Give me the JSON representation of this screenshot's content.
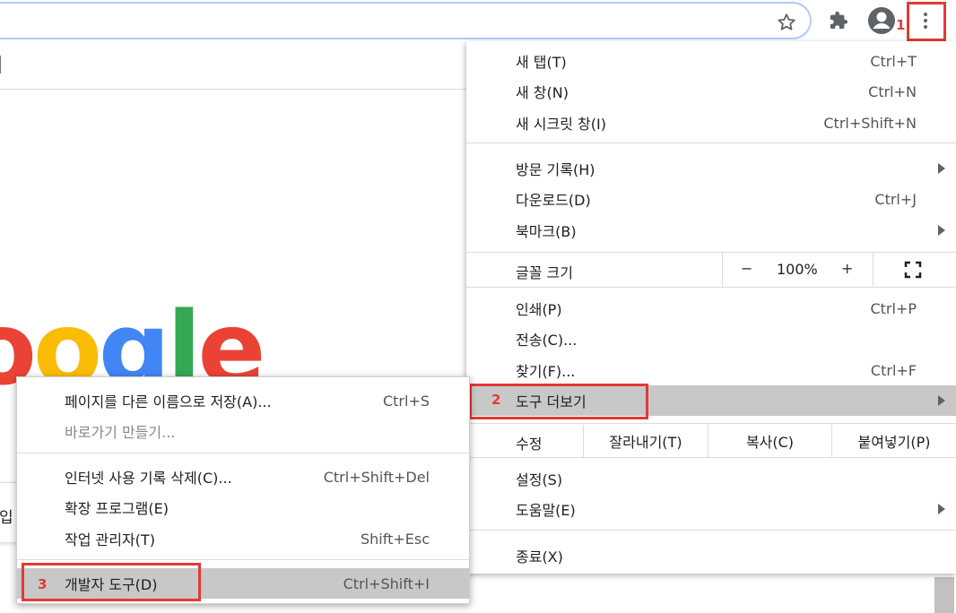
{
  "toolbar": {
    "step1": "1"
  },
  "menu": {
    "new_tab": {
      "label": "새 탭(T)",
      "shortcut": "Ctrl+T"
    },
    "new_window": {
      "label": "새 창(N)",
      "shortcut": "Ctrl+N"
    },
    "incognito": {
      "label": "새 시크릿 창(I)",
      "shortcut": "Ctrl+Shift+N"
    },
    "history": {
      "label": "방문 기록(H)"
    },
    "downloads": {
      "label": "다운로드(D)",
      "shortcut": "Ctrl+J"
    },
    "bookmarks": {
      "label": "북마크(B)"
    },
    "zoom": {
      "label": "글꼴 크기",
      "minus": "−",
      "value": "100%",
      "plus": "+"
    },
    "print": {
      "label": "인쇄(P)",
      "shortcut": "Ctrl+P"
    },
    "cast": {
      "label": "전송(C)..."
    },
    "find": {
      "label": "찾기(F)...",
      "shortcut": "Ctrl+F"
    },
    "more_tools": {
      "label": "도구 더보기",
      "step": "2"
    },
    "edit": {
      "label": "수정",
      "cut": "잘라내기(T)",
      "copy": "복사(C)",
      "paste": "붙여넣기(P)"
    },
    "settings": {
      "label": "설정(S)"
    },
    "help": {
      "label": "도움말(E)"
    },
    "exit": {
      "label": "종료(X)"
    }
  },
  "submenu": {
    "save_page": {
      "label": "페이지를 다른 이름으로 저장(A)...",
      "shortcut": "Ctrl+S"
    },
    "create_shortcut": {
      "label": "바로가기 만들기..."
    },
    "clear_data": {
      "label": "인터넷 사용 기록 삭제(C)...",
      "shortcut": "Ctrl+Shift+Del"
    },
    "extensions": {
      "label": "확장 프로그램(E)"
    },
    "task_manager": {
      "label": "작업 관리자(T)",
      "shortcut": "Shift+Esc"
    },
    "dev_tools": {
      "label": "개발자 도구(D)",
      "shortcut": "Ctrl+Shift+I",
      "step": "3"
    }
  },
  "page": {
    "logo_text": "oogle",
    "search_fragment": "입"
  },
  "colors": {
    "annotation_red": "#e53935",
    "highlight": "#c8c8c8",
    "google_blue": "#4285f4",
    "google_red": "#ea4335",
    "google_yellow": "#fbbc05",
    "google_green": "#34a853"
  },
  "icons": [
    "star-icon",
    "puzzle-icon",
    "profile-icon",
    "kebab-menu-icon",
    "submenu-arrow-icon",
    "fullscreen-icon"
  ]
}
